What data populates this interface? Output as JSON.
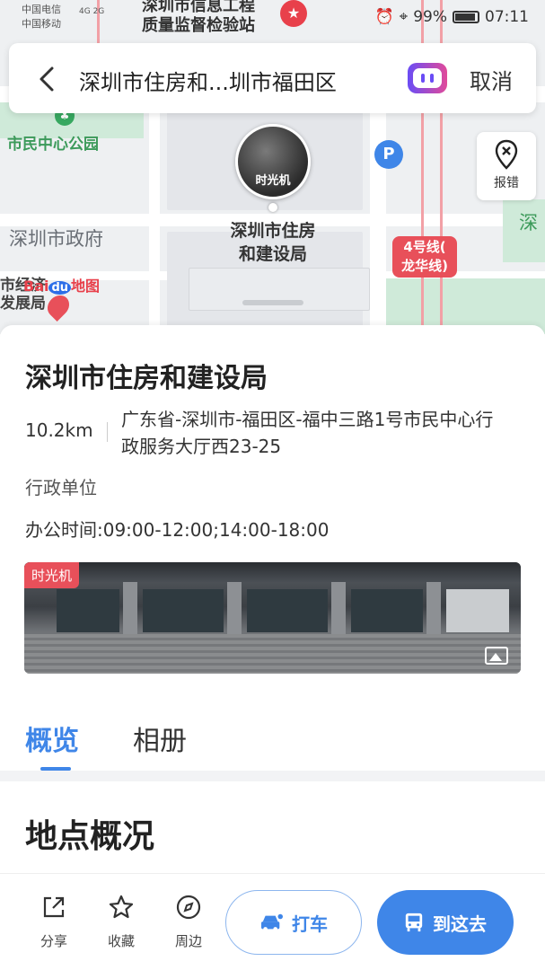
{
  "status_bar": {
    "carrier_1": "中国电信",
    "carrier_2": "中国移动",
    "signal_1": "4G",
    "signal_2": "2G",
    "battery": "99%",
    "time": "07:11"
  },
  "map": {
    "top_poi_line1": "深圳市信息工程",
    "top_poi_line2": "质量监督检验站",
    "park_label": "市民中心公园",
    "gov_label": "深圳市政府",
    "poi_name_line1": "深圳市住房",
    "poi_name_line2": "和建设局",
    "left_label_line1": "市经济",
    "left_label_line2": "发展局",
    "right_edge_label": "深",
    "time_machine_label": "时光机",
    "parking_label": "P",
    "metro_line_label_line1": "4号线(",
    "metro_line_label_line2": "龙华线)",
    "report_label": "报错",
    "baidu_logo_text": "Bai",
    "baidu_logo_du": "du",
    "baidu_logo_suffix": "地图"
  },
  "search": {
    "query": "深圳市住房和...圳市福田区",
    "cancel_label": "取消"
  },
  "poi": {
    "title": "深圳市住房和建设局",
    "distance": "10.2km",
    "address": "广东省-深圳市-福田区-福中三路1号市民中心行政服务大厅西23-25",
    "category": "行政单位",
    "hours": "办公时间:09:00-12:00;14:00-18:00",
    "photo_badge": "时光机"
  },
  "tabs": [
    {
      "label": "概览",
      "active": true
    },
    {
      "label": "相册",
      "active": false
    }
  ],
  "section_title": "地点概况",
  "bottom_bar": {
    "share_label": "分享",
    "favorite_label": "收藏",
    "nearby_label": "周边",
    "taxi_label": "打车",
    "go_label": "到这去"
  },
  "colors": {
    "accent": "#3f86e8",
    "metro_red": "#e8505a",
    "park_green": "#3c9a5a"
  }
}
